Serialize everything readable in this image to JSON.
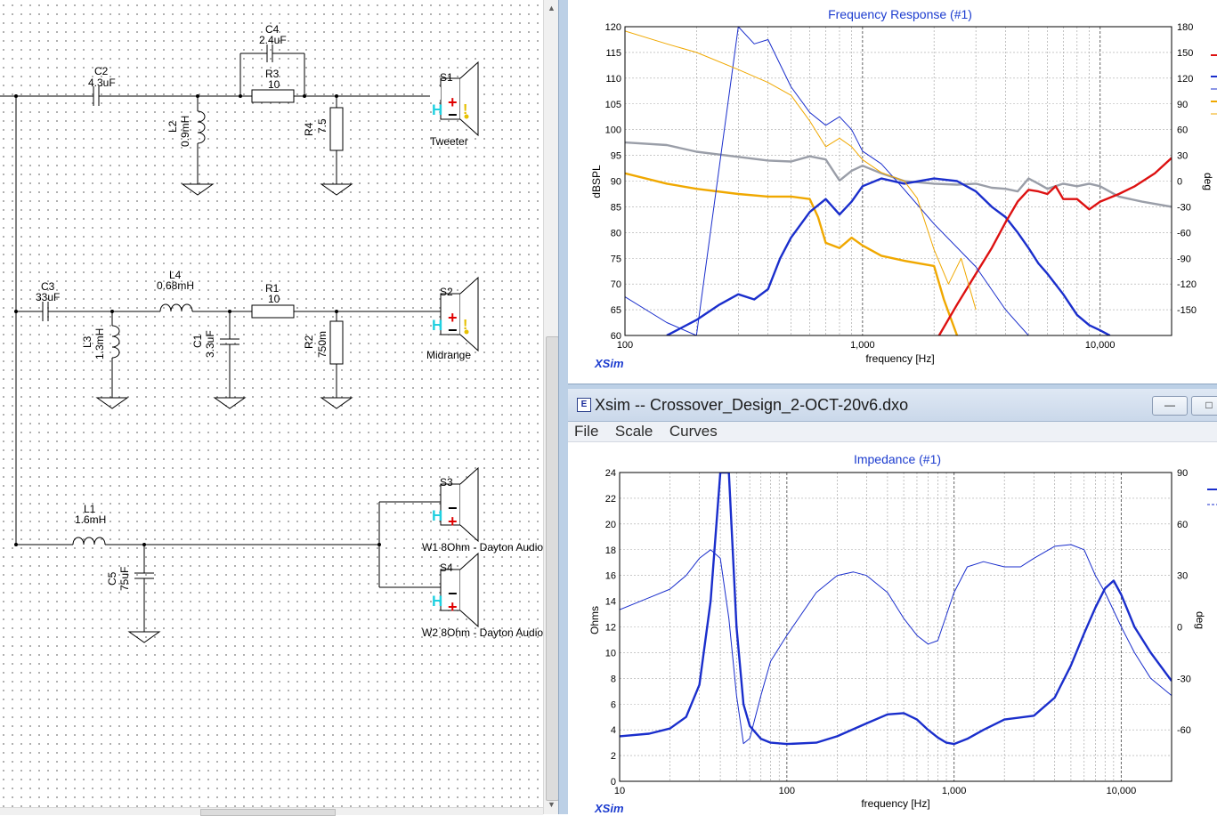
{
  "schematic": {
    "components": {
      "C2": {
        "ref": "C2",
        "value": "4.3uF"
      },
      "C4": {
        "ref": "C4",
        "value": "2.4uF"
      },
      "R3": {
        "ref": "R3",
        "value": "10"
      },
      "L2": {
        "ref": "L2",
        "value": "0.9mH"
      },
      "R4": {
        "ref": "R4",
        "value": "7.5"
      },
      "S1": {
        "ref": "S1",
        "caption": "Tweeter"
      },
      "C3": {
        "ref": "C3",
        "value": "33uF"
      },
      "L4": {
        "ref": "L4",
        "value": "0.68mH"
      },
      "R1": {
        "ref": "R1",
        "value": "10"
      },
      "L3": {
        "ref": "L3",
        "value": "1.3mH"
      },
      "C1": {
        "ref": "C1",
        "value": "3.3uF"
      },
      "R2": {
        "ref": "R2",
        "value": "750m"
      },
      "S2": {
        "ref": "S2",
        "caption": "Midrange"
      },
      "L1": {
        "ref": "L1",
        "value": "1.6mH"
      },
      "C5": {
        "ref": "C5",
        "value": "75uF"
      },
      "S3": {
        "ref": "S3",
        "caption": "W1 8Ohm - Dayton Audio"
      },
      "S4": {
        "ref": "S4",
        "caption": "W2 8Ohm - Dayton Audio"
      }
    },
    "speaker_h_label": "H",
    "speaker_plus": "+",
    "speaker_minus": "−"
  },
  "window": {
    "title": "Xsim -- Crossover_Design_2-OCT-20v6.dxo",
    "menus": [
      "File",
      "Scale",
      "Curves"
    ],
    "minimize_label": "—",
    "maximize_label": "□",
    "icon_glyph": "E"
  },
  "freq_chart": {
    "title": "Frequency Response (#1)",
    "xlabel": "frequency [Hz]",
    "ylabel": "dBSPL",
    "y2label": "deg",
    "brand": "XSim",
    "y_ticks": [
      "120",
      "115",
      "110",
      "105",
      "100",
      "95",
      "90",
      "85",
      "80",
      "75",
      "70",
      "65",
      "60"
    ],
    "y2_ticks": [
      "180",
      "150",
      "120",
      "90",
      "60",
      "30",
      "0",
      "-30",
      "-60",
      "-90",
      "-120",
      "-150"
    ],
    "x_ticks": [
      "100",
      "1,000",
      "10,000"
    ]
  },
  "imp_chart": {
    "title": "Impedance (#1)",
    "xlabel": "frequency [Hz]",
    "ylabel": "Ohms",
    "y2label": "deg",
    "brand": "XSim",
    "y_ticks": [
      "24",
      "22",
      "20",
      "18",
      "16",
      "14",
      "12",
      "10",
      "8",
      "6",
      "4",
      "2",
      "0"
    ],
    "y2_ticks": [
      "90",
      "60",
      "30",
      "0",
      "-30",
      "-60"
    ],
    "x_ticks": [
      "10",
      "100",
      "1,000",
      "10,000"
    ]
  },
  "chart_data": [
    {
      "type": "line",
      "title": "Frequency Response (#1)",
      "xlabel": "frequency [Hz]",
      "ylabel": "dBSPL",
      "y2label": "deg",
      "xscale": "log",
      "xlim": [
        100,
        20000
      ],
      "ylim": [
        60,
        120
      ],
      "y2lim": [
        -180,
        180
      ],
      "grid": true,
      "series": [
        {
          "color": "#9a9ea8",
          "axis": "left",
          "style": "thick",
          "x": [
            100,
            150,
            200,
            300,
            400,
            500,
            600,
            700,
            800,
            900,
            1000,
            1200,
            1500,
            2000,
            2500,
            3000,
            3500,
            4000,
            4500,
            5000,
            5500,
            6000,
            7000,
            8000,
            9000,
            10000,
            12000,
            15000,
            20000
          ],
          "y": [
            97.5,
            97,
            95.7,
            94.7,
            94,
            93.8,
            94.8,
            94.2,
            90.1,
            92,
            93,
            91.5,
            90,
            89.5,
            89.3,
            89.5,
            88.7,
            88.5,
            88,
            90.5,
            89.5,
            88.5,
            89.5,
            89,
            89.5,
            89,
            87,
            86,
            85
          ]
        },
        {
          "color": "#f0a800",
          "axis": "left",
          "style": "thick",
          "x": [
            100,
            150,
            200,
            300,
            400,
            500,
            600,
            650,
            700,
            800,
            900,
            1000,
            1200,
            1500,
            2000,
            2200,
            2500
          ],
          "y": [
            91.5,
            89.5,
            88.5,
            87.5,
            87,
            87,
            86.5,
            83,
            78,
            77,
            79,
            77.5,
            75.5,
            74.5,
            73.5,
            67,
            60
          ]
        },
        {
          "color": "#1a2ecc",
          "axis": "left",
          "style": "thick",
          "x": [
            150,
            200,
            250,
            300,
            350,
            400,
            450,
            500,
            600,
            700,
            800,
            900,
            1000,
            1200,
            1500,
            2000,
            2500,
            3000,
            3500,
            4000,
            4500,
            5000,
            5500,
            6000,
            7000,
            8000,
            9000,
            10000,
            11000
          ],
          "y": [
            60,
            63,
            66,
            68,
            67,
            69,
            75,
            79,
            84,
            86.5,
            83.5,
            86,
            89,
            90.5,
            89.5,
            90.5,
            90,
            88,
            85,
            83,
            80,
            77,
            74,
            72,
            68,
            64,
            62,
            61,
            60
          ]
        },
        {
          "color": "#dd1111",
          "axis": "left",
          "style": "thick",
          "x": [
            2100,
            2500,
            3000,
            3500,
            4000,
            4500,
            5000,
            5500,
            6000,
            6500,
            7000,
            8000,
            9000,
            10000,
            12000,
            14000,
            17000,
            20000
          ],
          "y": [
            60,
            66,
            72,
            77,
            82,
            86,
            88.3,
            88,
            87.5,
            89,
            86.5,
            86.5,
            84.5,
            86,
            87.5,
            89,
            91.5,
            94.5
          ]
        },
        {
          "color": "#1a2ecc",
          "axis": "right",
          "style": "thin",
          "x": [
            100,
            150,
            200,
            300,
            350,
            400,
            500,
            600,
            700,
            800,
            900,
            1000,
            1200,
            1500,
            2000,
            3000,
            4000,
            5000
          ],
          "y": [
            -135,
            -165,
            -180,
            180,
            160,
            165,
            110,
            80,
            65,
            75,
            60,
            35,
            20,
            -10,
            -50,
            -100,
            -150,
            -180
          ]
        },
        {
          "color": "#f0a800",
          "axis": "right",
          "style": "thin",
          "x": [
            100,
            150,
            200,
            300,
            400,
            500,
            600,
            700,
            800,
            900,
            1000,
            1200,
            1500,
            1700,
            2000,
            2300,
            2600,
            3000
          ],
          "y": [
            175,
            160,
            150,
            130,
            115,
            100,
            70,
            40,
            50,
            40,
            25,
            10,
            0,
            -20,
            -80,
            -120,
            -90,
            -150
          ]
        }
      ]
    },
    {
      "type": "line",
      "title": "Impedance (#1)",
      "xlabel": "frequency [Hz]",
      "ylabel": "Ohms",
      "y2label": "deg",
      "xscale": "log",
      "xlim": [
        10,
        20000
      ],
      "ylim": [
        0,
        24
      ],
      "y2lim": [
        -90,
        90
      ],
      "grid": true,
      "series": [
        {
          "color": "#1a2ecc",
          "axis": "left",
          "style": "thick",
          "x": [
            10,
            15,
            20,
            25,
            30,
            35,
            40,
            45,
            50,
            55,
            60,
            70,
            80,
            100,
            150,
            200,
            300,
            400,
            500,
            600,
            700,
            800,
            900,
            1000,
            1200,
            1500,
            2000,
            3000,
            4000,
            5000,
            6000,
            7000,
            8000,
            9000,
            10000,
            12000,
            15000,
            20000
          ],
          "y": [
            3.5,
            3.7,
            4.1,
            5,
            7.5,
            14,
            24,
            24,
            12,
            6,
            4.3,
            3.3,
            3,
            2.9,
            3,
            3.5,
            4.5,
            5.2,
            5.3,
            4.8,
            4,
            3.4,
            3,
            2.9,
            3.3,
            4,
            4.8,
            5.1,
            6.5,
            9,
            11.5,
            13.5,
            15,
            15.6,
            14.5,
            12,
            10,
            7.8
          ]
        },
        {
          "color": "#1a2ecc",
          "axis": "right",
          "style": "thin",
          "x": [
            10,
            15,
            20,
            25,
            30,
            35,
            40,
            45,
            50,
            55,
            60,
            70,
            80,
            100,
            150,
            200,
            250,
            300,
            400,
            500,
            600,
            700,
            800,
            1000,
            1200,
            1500,
            2000,
            2500,
            3000,
            4000,
            5000,
            6000,
            7000,
            8000,
            10000,
            12000,
            15000,
            20000
          ],
          "y": [
            10,
            17,
            22,
            30,
            40,
            45,
            40,
            5,
            -40,
            -68,
            -65,
            -40,
            -20,
            -5,
            20,
            30,
            32,
            30,
            20,
            5,
            -5,
            -10,
            -8,
            20,
            35,
            38,
            35,
            35,
            40,
            47,
            48,
            45,
            30,
            20,
            0,
            -15,
            -30,
            -40
          ]
        }
      ]
    }
  ]
}
